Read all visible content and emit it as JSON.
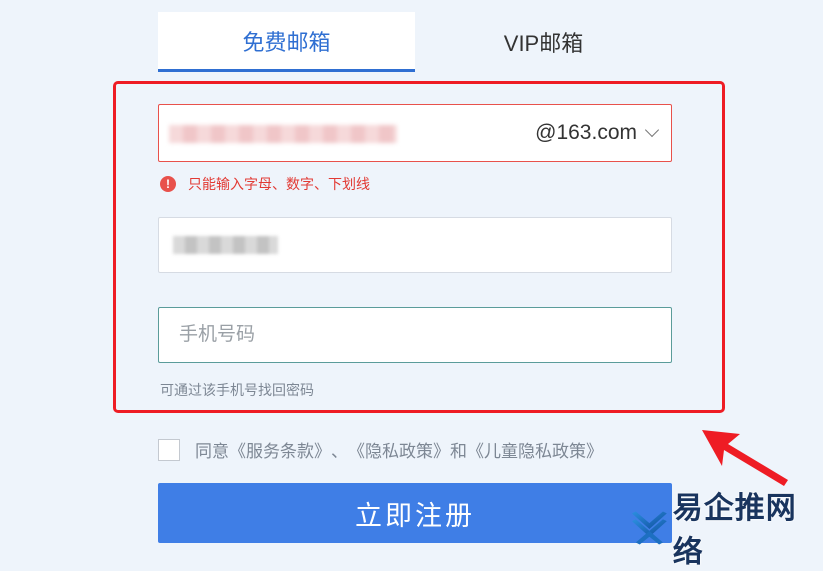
{
  "tabs": [
    {
      "label": "免费邮箱",
      "active": true
    },
    {
      "label": "VIP邮箱",
      "active": false
    }
  ],
  "form": {
    "email_domain": "@163.com",
    "email_error": "只能输入字母、数字、下划线",
    "error_icon": "!",
    "phone_placeholder": "手机号码",
    "phone_hint": "可通过该手机号找回密码"
  },
  "agreement": {
    "prefix": "同意",
    "service_terms": "《服务条款》",
    "sep": "、",
    "privacy_policy": "《隐私政策》",
    "and": "和",
    "children_policy": "《儿童隐私政策》"
  },
  "register_button": "立即注册",
  "watermark_text": "易企推网络",
  "colors": {
    "accent": "#3f7ee6",
    "error": "#e23a34",
    "highlight": "#ee1c24"
  }
}
